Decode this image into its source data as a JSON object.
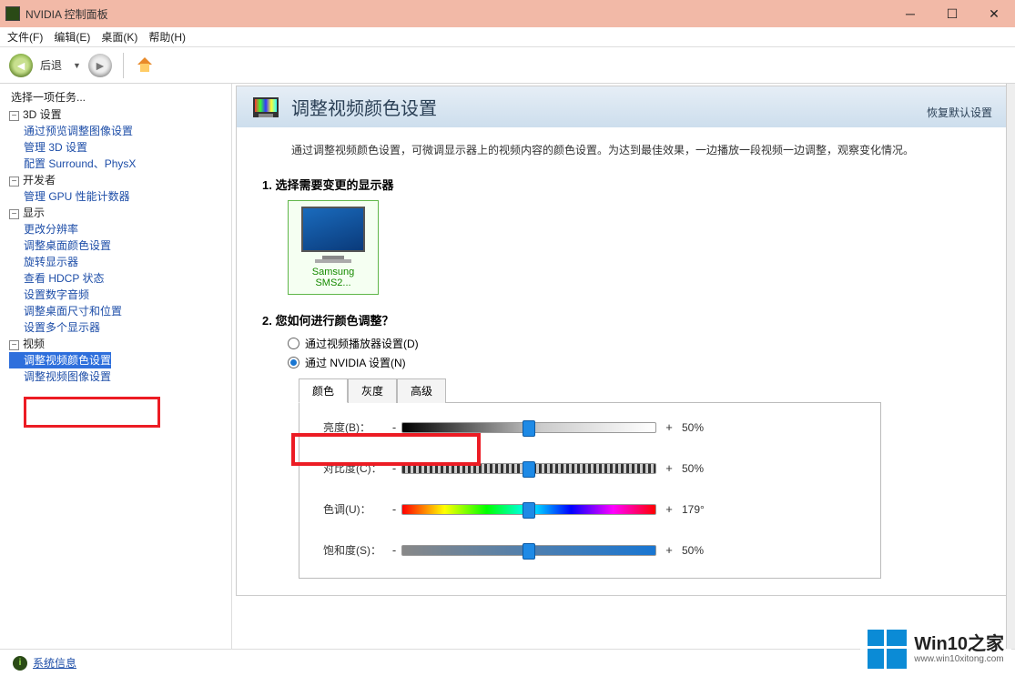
{
  "window": {
    "title": "NVIDIA 控制面板"
  },
  "menu": {
    "file": "文件(F)",
    "edit": "编辑(E)",
    "desktop": "桌面(K)",
    "help": "帮助(H)"
  },
  "toolbar": {
    "back": "后退"
  },
  "sidebar": {
    "task_prompt": "选择一项任务...",
    "groups": [
      {
        "label": "3D 设置",
        "items": [
          "通过预览调整图像设置",
          "管理 3D 设置",
          "配置 Surround、PhysX"
        ]
      },
      {
        "label": "开发者",
        "items": [
          "管理 GPU 性能计数器"
        ]
      },
      {
        "label": "显示",
        "items": [
          "更改分辨率",
          "调整桌面颜色设置",
          "旋转显示器",
          "查看 HDCP 状态",
          "设置数字音频",
          "调整桌面尺寸和位置",
          "设置多个显示器"
        ]
      },
      {
        "label": "视频",
        "items": [
          "调整视频颜色设置",
          "调整视频图像设置"
        ]
      }
    ],
    "selected": "调整视频颜色设置"
  },
  "page": {
    "title": "调整视频颜色设置",
    "restore": "恢复默认设置",
    "description": "通过调整视频颜色设置，可微调显示器上的视频内容的颜色设置。为达到最佳效果，一边播放一段视频一边调整，观察变化情况。",
    "section1_title": "1. 选择需要变更的显示器",
    "monitor_name": "Samsung SMS2...",
    "section2_title": "2. 您如何进行颜色调整？",
    "radio_player": "通过视频播放器设置(D)",
    "radio_nvidia": "通过 NVIDIA 设置(N)",
    "tabs": {
      "color": "颜色",
      "gamma": "灰度",
      "advanced": "高级"
    },
    "sliders": {
      "brightness": {
        "label": "亮度(B)：",
        "value": "50%",
        "pos": 50
      },
      "contrast": {
        "label": "对比度(C)：",
        "value": "50%",
        "pos": 50
      },
      "hue": {
        "label": "色调(U)：",
        "value": "179°",
        "pos": 50
      },
      "saturation": {
        "label": "饱和度(S)：",
        "value": "50%",
        "pos": 50
      }
    }
  },
  "statusbar": {
    "sysinfo": "系统信息"
  },
  "watermark": {
    "brand": "Win10之家",
    "url": "www.win10xitong.com"
  }
}
